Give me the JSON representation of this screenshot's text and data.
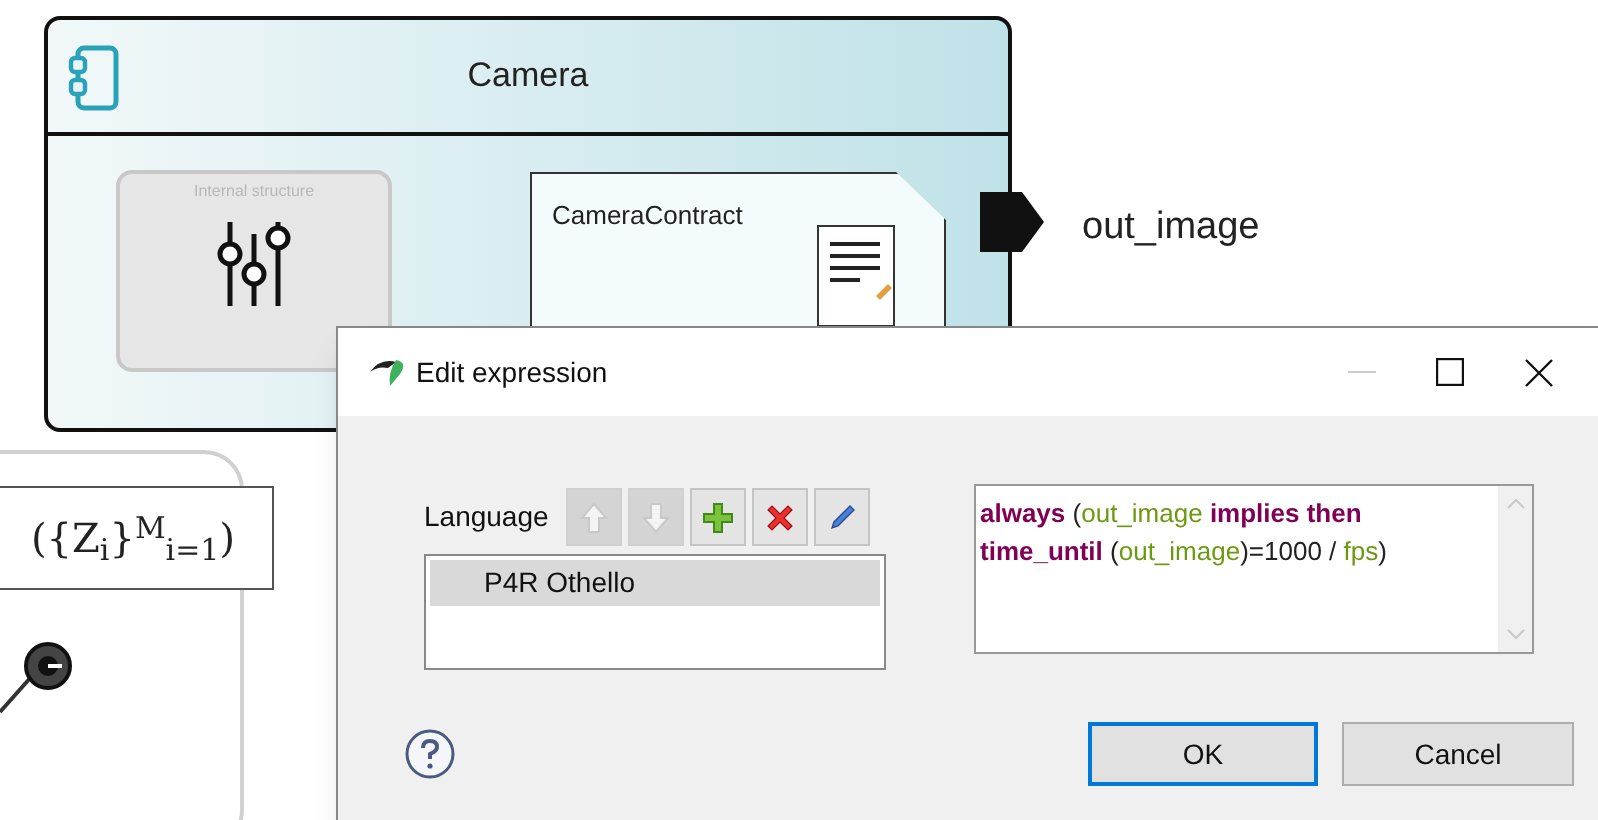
{
  "component": {
    "title": "Camera",
    "internal_structure": {
      "label": "Internal structure"
    },
    "contract": {
      "label": "CameraContract"
    },
    "port": {
      "label": "out_image"
    }
  },
  "formula_panel": {
    "formula": "({Z$_{i}$}$^{M}$$_{i=1}$)"
  },
  "dialog": {
    "title": "Edit expression",
    "language_label": "Language",
    "toolbar": [
      {
        "kind": "up",
        "disabled": true
      },
      {
        "kind": "down",
        "disabled": true
      },
      {
        "kind": "add",
        "disabled": false
      },
      {
        "kind": "delete",
        "disabled": false
      },
      {
        "kind": "edit",
        "disabled": false
      }
    ],
    "languages": [
      {
        "label": "P4R Othello",
        "selected": true
      }
    ],
    "expression": [
      [
        {
          "kind": "keyword",
          "text": "always"
        },
        {
          "kind": "plain",
          "text": " ("
        },
        {
          "kind": "variable",
          "text": "out_image"
        },
        {
          "kind": "keyword",
          "text": " implies then"
        }
      ],
      [
        {
          "kind": "keyword",
          "text": "time_until"
        },
        {
          "kind": "plain",
          "text": " ("
        },
        {
          "kind": "variable",
          "text": "out_image"
        },
        {
          "kind": "plain",
          "text": ")=1000 / "
        },
        {
          "kind": "variable",
          "text": "fps"
        },
        {
          "kind": "plain",
          "text": ")"
        }
      ]
    ],
    "buttons": [
      {
        "label": "OK",
        "default": true
      },
      {
        "label": "Cancel",
        "default": false
      }
    ]
  }
}
